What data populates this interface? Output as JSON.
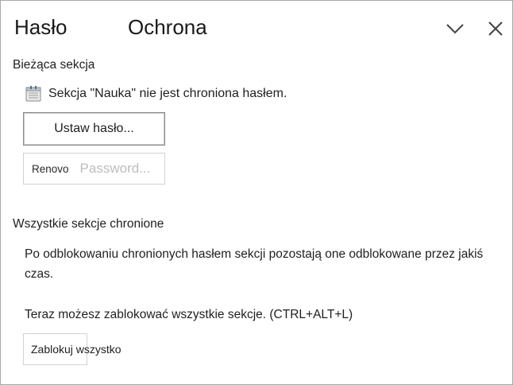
{
  "header": {
    "tabs": [
      {
        "label": "Hasło"
      },
      {
        "label": "Ochrona"
      }
    ],
    "chevron_icon": "chevron-down-icon",
    "close_icon": "close-icon"
  },
  "current_section": {
    "title": "Bieżąca sekcja",
    "icon": "notebook-section-icon",
    "status_text": "Sekcja \"Nauka\" nie jest chroniona hasłem.",
    "set_password_label": "Ustaw hasło...",
    "remove_password_word1": "Renovo",
    "remove_password_word2": "Password..."
  },
  "all_sections": {
    "title": "Wszystkie sekcje chronione",
    "paragraph1": "Po odblokowaniu chronionych hasłem sekcji pozostają one odblokowane przez jakiś czas.",
    "paragraph2": "Teraz możesz zablokować wszystkie sekcje. (CTRL+ALT+L)",
    "lock_all_label": "Zablokuj wszystko"
  },
  "colors": {
    "border": "#a9a9a9",
    "text": "#1f1f1f",
    "disabled_text": "#bdbdbd",
    "button_border": "#8a8a8a"
  }
}
